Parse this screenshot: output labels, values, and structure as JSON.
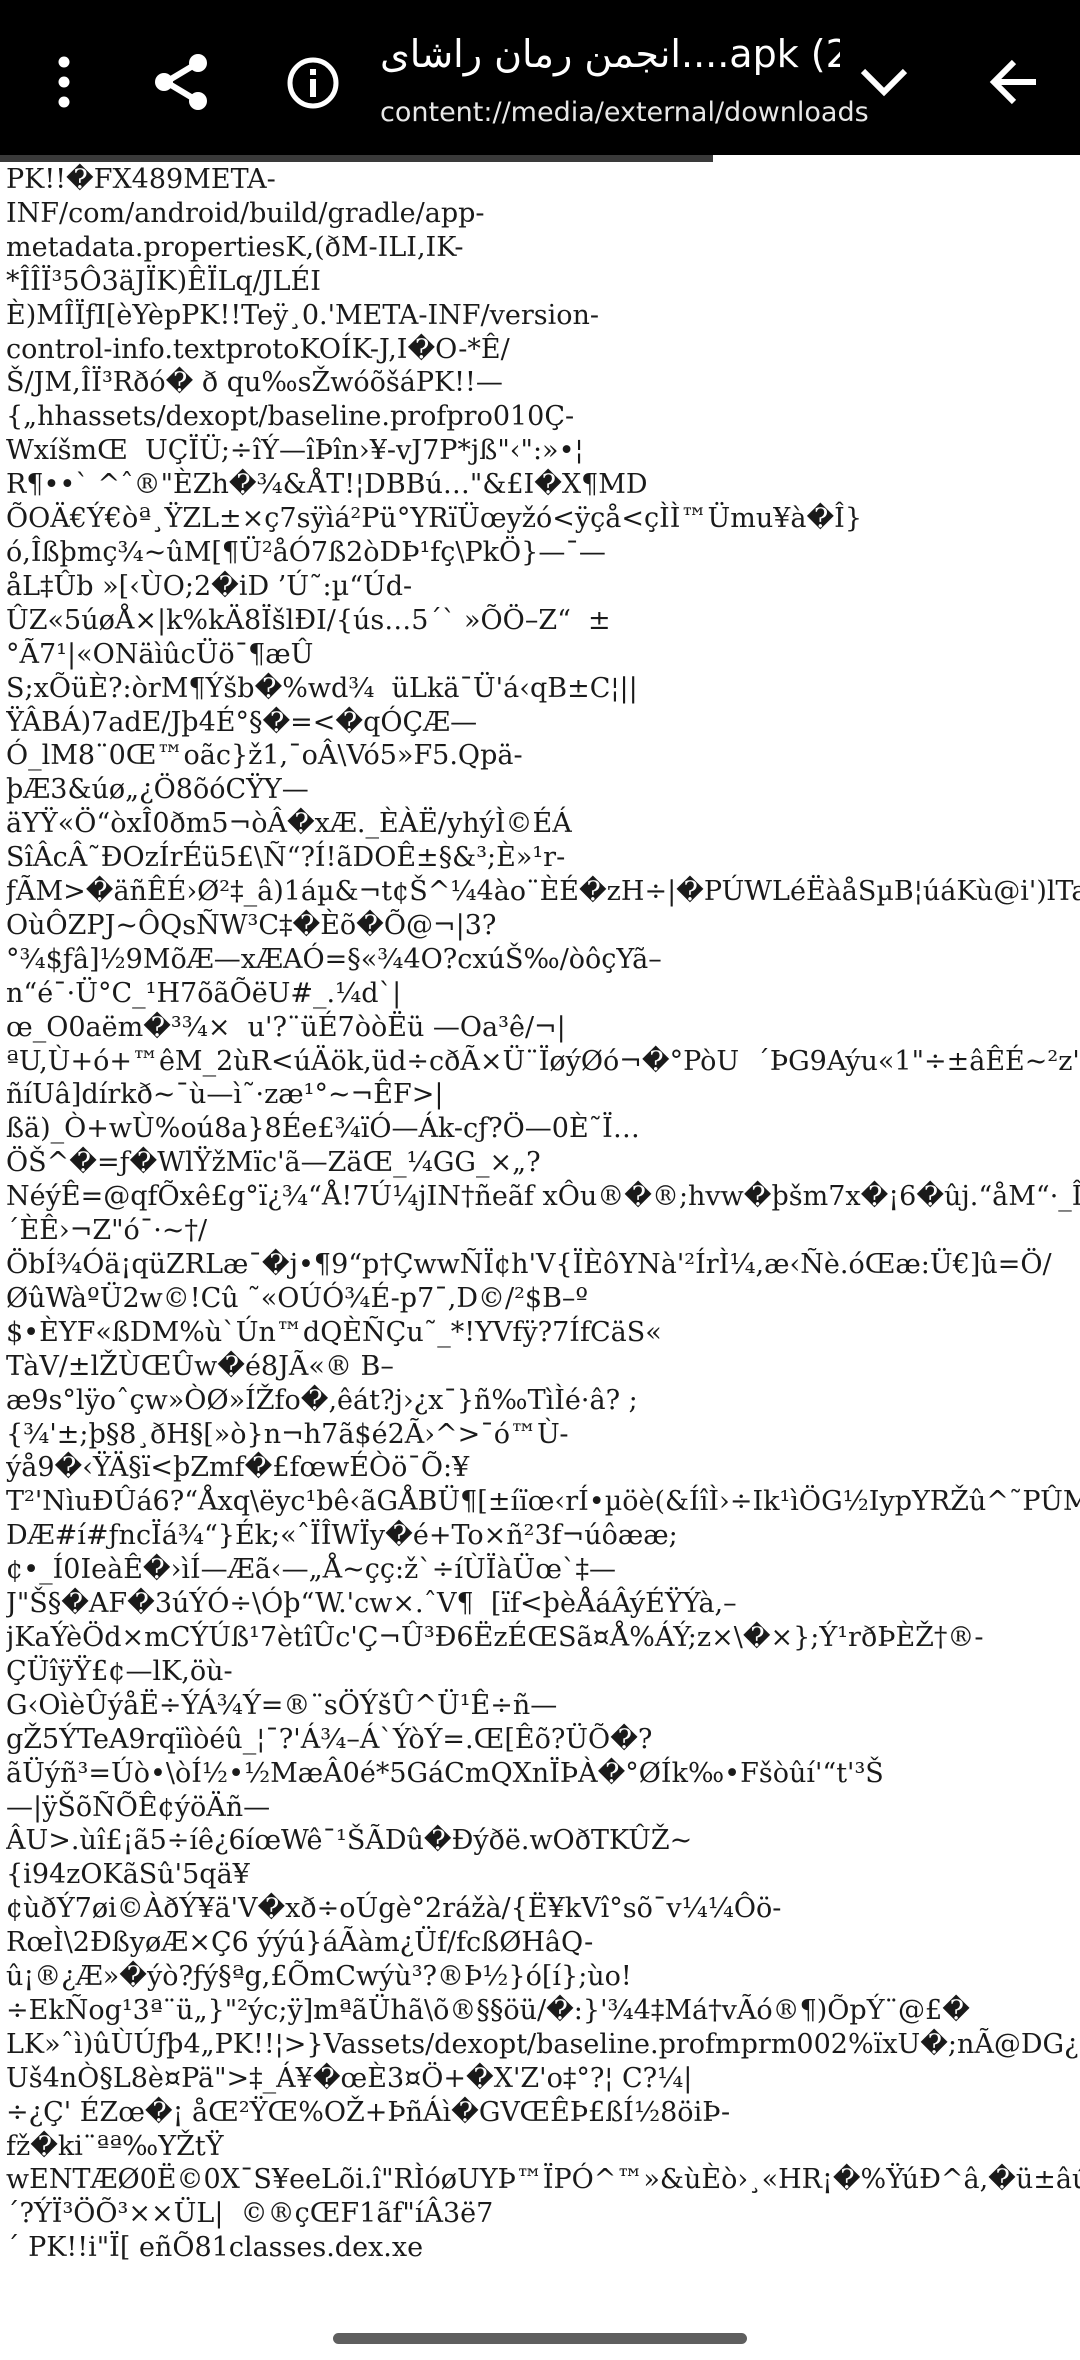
{
  "app_bar": {
    "title": "انجمن رمان راشای....apk (2",
    "subtitle": "content://media/external/downloads",
    "icons": {
      "back": "arrow-back-icon",
      "expand": "chevron-down-icon",
      "info": "info-icon",
      "share": "share-icon",
      "more": "more-vert-icon"
    },
    "colors": {
      "background": "#000000",
      "foreground": "#ffffff"
    }
  },
  "progress": {
    "fraction": 0.66
  },
  "document": {
    "text": "PK!!�FX489META-\nINF/com/android/build/gradle/app-\nmetadata.propertiesK,(ðM-ILI,IK-\n*ÎÎÏ³5Ô3äJÏK)ÊÏLq/JLÉI\nÈ)MÎÏƒI[èYèpPK!!Teÿ¸0.'META-INF/version-\ncontrol-info.textprotoKOÍK-J,I�O-*Ê/\nŠ/JM,ÎÏ³Rðó� ð qu‰sŽwóõšáPK!!—\n{„hhassets/dexopt/baseline.profpro010Ç-\nWxíšmŒ  UÇÏÜ;÷îÝ—îÞîn›¥-vJ7P*jß\"‹\":»•¦\nR¶••` ^ˆ®\"ÈZh�¾&ÅT!¦DBBú…\"&£I�X¶MD\nÕOÄ€Ý€òª¸ŸZL±×ç7sÿìá²Pü°YRïÜœyžó<ÿçå<çÌÌ™Ümu¥à�Î}\nó,Îßþmç¾~ûM[¶Ü²åÓ7ß2òDÞ¹fç\\PkÖ}—¯—\nåL‡Ûb »[‹ÙO;2�iD ’Ú˜:µ“Úd-\nÛZ«5úøÅ×|k%kÄ8ÏšlÐI/{ús…5´` »ÕÖ–Z“  ±\n°Ã7¹|«ONäìûcÜö¯¶æÛ\nS;xÕüÈ?:òrM¶Ýšb�%wd¾  üLkä¯Ü'á‹qB±C¦||\nŸÂBÁ)7adE/Jþ4É°§�=<�qÓÇÆ—\nÓ_lM8¨0Œ™oãc}ž1,¯oÂ\\Vó5»F5.Qpä-\nþÆ3&úø„¿Ö8õóCŸY—\näYŸ«Ö“òxÎ0ðm5¬òÂ�xÆ._ÈÀË/yhýÌ©ÉÁ\nSîÂcÂ˜ÐOzÍrÉü5£\\Ñ“?Í!ãDOÊ±§&³;È»¹r-\nƒÃM>�äñÊÉ›Ø²‡_â)1áµ&¬t¢Š^¼4ào¨ÈÉ�zH÷|�PÚWLéËàåSµB¦úáKù@i')lTa•“ü\nOùÔZPJ~ÔQsÑW³C‡�Èõ�Õ@¬|3?\n°¾$ƒâ]½9MõÆ—xÆAÓ=§«¾4O?cxúŠ‰/òôçYã–\nn“é¯·Ü°C_¹H7õãÕëU#_.¼d`|\nœ_O0aëm�³¾×  u'?¨üÉ7òòËü —Oa³ê/¬|\nªU,Ù+ó+™êM_2ùR<úÄök,üd÷cðÃ×Ü¨ÏøýØó¬�°PòU  ´ÞG9Aýu«1\"÷±âÊÉ~²z\"÷cÈ\nñíUâ]dírkð~¯ù—ì˜·zæ¹°~¬ÊF>|\nßä)_Ò+wÙ%oú8a}8Ée£¾ïÓ—Ák-cƒ?Ö—0È˜Ï…\nÖŠ^�=ƒ�WlŸžMïc'ã—ZäŒ_¼GG_×„?\nNéýÊ=@qfÕxê£g°ï¿¾“Å!7Ú¼jIN†ñeãf xÔu®�®;hvw�þšm7x�¡6�ûj.“åM“·_Îîy©\n´ÈÊ›¬Z\"ó¯·~†/\nÖbÍ¾Óä¡qüZRLæ¯�j•¶9“p†ÇwwÑÏ¢h'V{ÏÈôYNà'²ÍrÌ¼,æ‹Ñè.óŒæ:Ü€]û=Ö/\nØûWàºÜ2w©!Cû ˜«OÚÓ¾É-p7¯,D©/²$B–º\n$•ÈYF«ßDM%ù`Ún™dQÈÑÇu˜_*!YVfÿ?7ÍfCäS«\nTàV/±lŽÙŒÛw�é8JÃ«® B–\næ9s°lÿoˆçw»ÒØ»ÍŽfo�,êát?j›¿x¯}ñ‰TìÌé·â? ;\n{¾'±;þ§8¸ðH§[»ò}n¬h7ã$é2Ã›^>¯ó™Ù-\nýå9�‹ŸÄ§ï<þZmf�£fœwÉÒö¯Õ:¥\nT²'NìuÐÛá6?“Åxq\\ëyc¹bê‹ãGÅBÜ¶[±íïœ‹rÍ•µöè(&ÍîÌ›÷Ik¹ìÖG½IypYRŽû^˜PÛM\nDÆ#í#ƒncÏá¾“}Ék;«ˆÏÎWÏy�é+To×ñ²3f¬úôææ;\n¢•_Í0IeàÊ�›ìÍ—Æã‹—„Å~çç:ž`÷íÙÏàÜœ`‡—\nJ\"Š§�AF�3úÝÓ÷\\Óþ“W.'cw×.ˆV¶  [ïf<þèÅáÂýÉŸÝà,–\njKaÝèÖd×mCÝÚß¹7ètîÛc'Ç¬Û³Ð6ËzÉŒSã¤Å%ÁÝ;z×\\�×};Ý¹rðÞÈŽ†®-\nÇÜîÿŸ£¢—lK,öù-\nG‹OìèÛýåË÷ÝÁ¾Ý=®¨sÖÝšÛ^Ü¹Ê÷ñ—\ngŽ5ÝTeA9rqïìòéû_¦¯?'Á¾–Á`ÝòÝ=.Œ[Êõ?ÜÕ�?\nãÜýñ³=Úò•\\òÍ½•½MæÂ0é*5GáCmQXnÏÞÀ�°ØÍk‰•Fšòûí'“t'³Š\n—|ÿŠõÑÕÊ¢ýöÄñ—\nÂU>.ùî£¡ã5÷íê¿6íœWê¯¹ŠÃDû�Ðýðë.wOðTKÛŽ~\n{i94zOKãSû'5qä¥\n¢ùðÝ7øi©ÀðÝ¥ä'V�xð÷oÚgè°2rážà/{Ë¥kVî°sõ¯v¼¼Ôö-\nRœÌ\\2ÐßyøÆ×Ç6 ýýú}áÃàm¿Üf/fcßØHâQ-\nû¡®¿Æ»�ýò?ƒý§ªg,£ÕmCwýù³?®Þ½}ó[í};ùo!\n÷EkÑog¹3ª¨ü„}\"²ýc;ÿ]mªãÜhã\\õ®§§öü/�:}'¾4‡Má†vÃó®¶)ÕpÝ¨@£�\nLK»ˆì)ûÙÚƒþ4„PK!!¦>}Vassets/dexopt/baseline.profmprm002%ïxU�;nÃ@DG¿<\nUš4nÒ§L8è¤Pä\">‡_Á¥�œÈ3¤Ö+�X'Z'o‡°?¦ C?¼|\n÷¿Ç' ÉZœ�¡ åŒ²ŸŒ%OŽ+ÞñÁì�GVŒÊÞ£ßÍ½8öiÞ-\nfž�ki¨ªª‰YŽtŸ\nwENTÆØ0Ë©0X¯S¥eeLõi.î\"RÌóøUYÞ™ÏPÓ^™»&ùÈò›¸«HR¡�%ŸúÐ^â,�ü±âú“¯F\n´?ÝÏ³ÖÕ³××ÜL|  ©®çŒF1ãf\"íÂ3ë7\n´ PK!!i\"Ï[ eñÕ81classes.dex.xe"
  }
}
